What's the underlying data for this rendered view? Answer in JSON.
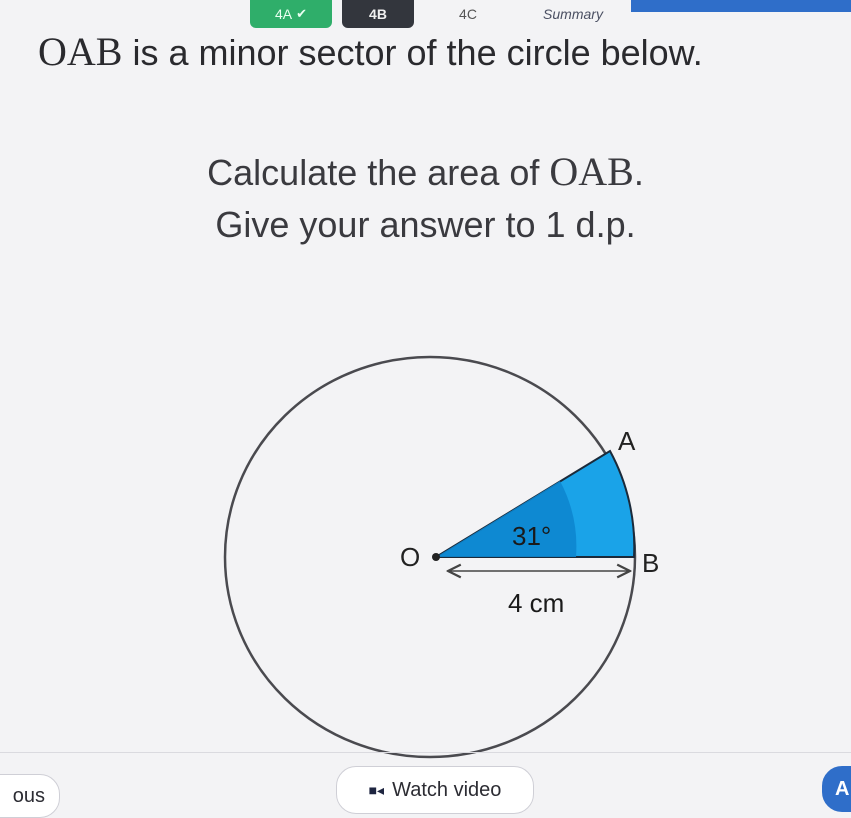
{
  "tabs": [
    {
      "label": "4A",
      "state": "completed"
    },
    {
      "label": "4B",
      "state": "active"
    },
    {
      "label": "4C",
      "state": "inactive"
    },
    {
      "label": "Summary",
      "state": "inactive"
    }
  ],
  "question": {
    "title_math": "OAB",
    "title_text": " is a minor sector of the circle below.",
    "line1_text": "Calculate the area of ",
    "line1_math": "OAB",
    "line1_end": ".",
    "line2": "Give your answer to 1 d.p."
  },
  "diagram": {
    "center_label": "O",
    "point_a_label": "A",
    "point_b_label": "B",
    "angle_label": "31°",
    "radius_label": "4 cm",
    "sector_color": "#1aa3e8",
    "angle_fill_color": "#0d86cf"
  },
  "footer": {
    "previous_label": "ous",
    "watch_video_label": "Watch video",
    "next_label": "A"
  },
  "colors": {
    "completed_tab": "#2fae6a",
    "active_tab": "#33363d",
    "accent_blue": "#2f6ec9"
  }
}
